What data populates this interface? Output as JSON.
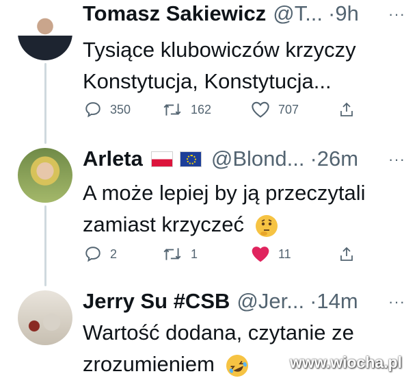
{
  "tweets": [
    {
      "name": "Tomasz Sakiewicz",
      "handle": "@T...",
      "time": "·9h",
      "more": "···",
      "lines": [
        "Tysiące klubowiczów krzyczy",
        "Konstytucja, Konstytucja..."
      ],
      "reply_count": "350",
      "retweet_count": "162",
      "like_count": "707",
      "liked": false
    },
    {
      "name": "Arleta",
      "handle": "@Blond...",
      "time": "·26m",
      "more": "···",
      "lines": [
        "A może lepiej by ją przeczytali",
        "zamiast krzyczeć"
      ],
      "reply_count": "2",
      "retweet_count": "1",
      "like_count": "11",
      "liked": true
    },
    {
      "name": "Jerry Su #CSB",
      "handle": "@Jer...",
      "time": "·14m",
      "more": "···",
      "lines": [
        "Wartość dodana, czytanie ze",
        "zrozumieniem"
      ]
    }
  ],
  "icons": {
    "reply": "reply-icon",
    "retweet": "retweet-icon",
    "like": "heart-icon",
    "share": "share-icon",
    "thinking": "thinking-face-emoji",
    "rofl": "rolling-laughing-emoji"
  },
  "colors": {
    "text": "#0f1419",
    "secondary": "#536471",
    "like_active": "#f91880",
    "thread_line": "#cfd9de"
  },
  "watermark": "www.wiocha.pl"
}
